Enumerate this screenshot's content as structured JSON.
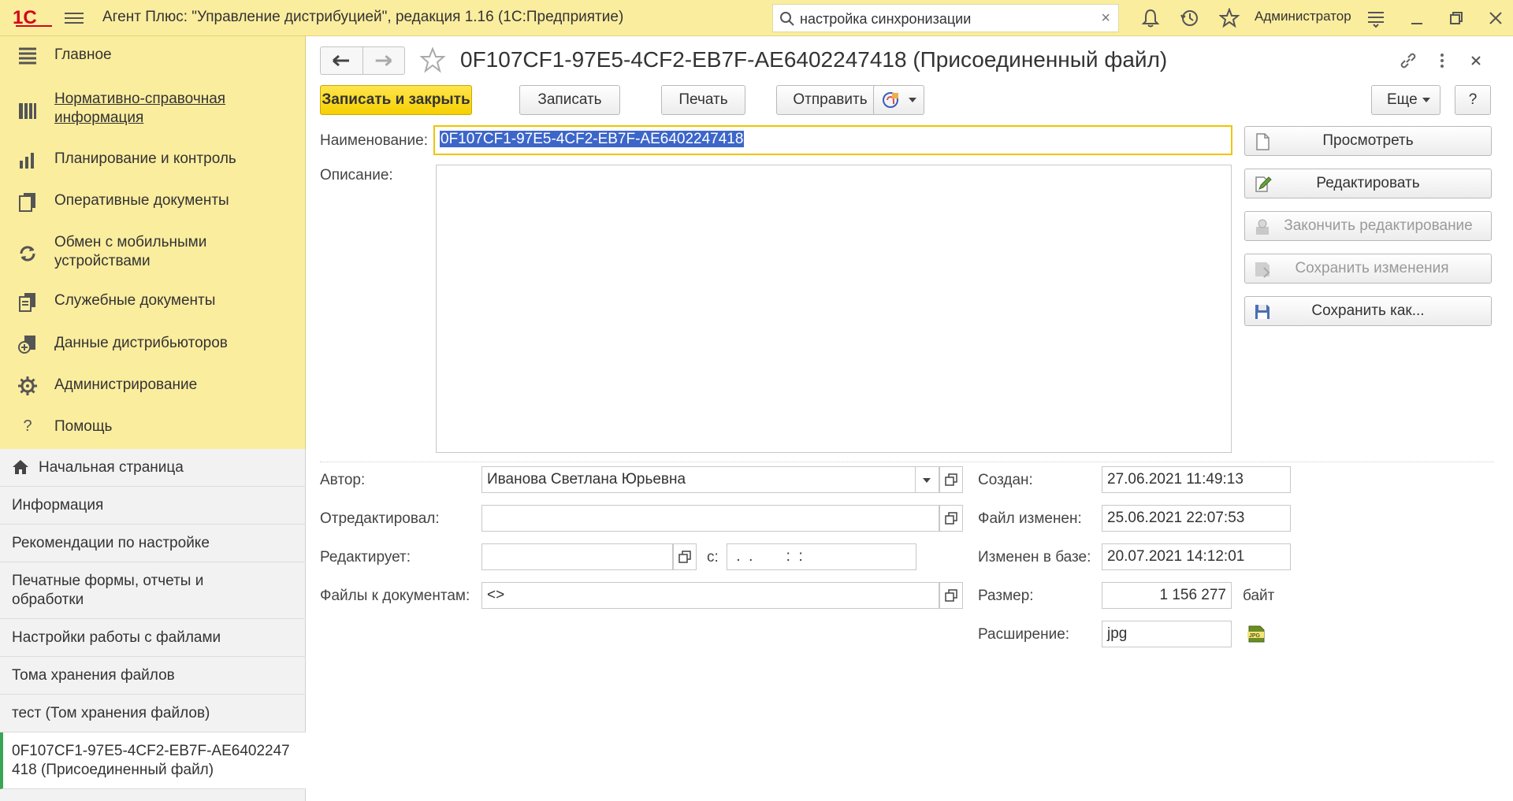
{
  "app": {
    "title": "Агент Плюс: \"Управление дистрибуцией\", редакция 1.16  (1С:Предприятие)",
    "search_value": "настройка синхронизации",
    "user": "Администратор"
  },
  "sections": [
    {
      "label": "Главное",
      "icon": "list-icon"
    },
    {
      "label": "Нормативно-справочная информация",
      "icon": "catalog-icon"
    },
    {
      "label": "Планирование и контроль",
      "icon": "chart-icon"
    },
    {
      "label": "Оперативные документы",
      "icon": "documents-icon"
    },
    {
      "label": "Обмен с мобильными устройствами",
      "icon": "sync-icon"
    },
    {
      "label": "Служебные документы",
      "icon": "service-docs-icon"
    },
    {
      "label": "Данные дистрибьюторов",
      "icon": "distributor-icon"
    },
    {
      "label": "Администрирование",
      "icon": "gear-icon"
    },
    {
      "label": "Помощь",
      "icon": "help-icon"
    }
  ],
  "open_windows": [
    {
      "label": "Начальная страница"
    },
    {
      "label": "Информация"
    },
    {
      "label": "Рекомендации по настройке"
    },
    {
      "label": "Печатные формы, отчеты и обработки"
    },
    {
      "label": "Настройки работы с файлами"
    },
    {
      "label": "Тома хранения файлов"
    },
    {
      "label": "тест (Том хранения файлов)"
    },
    {
      "label": "0F107CF1-97E5-4CF2-EB7F-AE6402247418 (Присоединенный файл)"
    }
  ],
  "form": {
    "title": "0F107CF1-97E5-4CF2-EB7F-AE6402247418 (Присоединенный файл)",
    "toolbar": {
      "save_close": "Записать и закрыть",
      "save": "Записать",
      "print": "Печать",
      "send": "Отправить",
      "more": "Еще",
      "help": "?"
    },
    "side_buttons": {
      "view": "Просмотреть",
      "edit": "Редактировать",
      "finish_edit": "Закончить редактирование",
      "save_changes": "Сохранить изменения",
      "save_as": "Сохранить как..."
    },
    "labels": {
      "name": "Наименование:",
      "description": "Описание:",
      "author": "Автор:",
      "edited_by": "Отредактировал:",
      "editing": "Редактирует:",
      "since": "с:",
      "files_to_docs": "Файлы к документам:",
      "created": "Создан:",
      "file_changed": "Файл изменен:",
      "changed_in_db": "Изменен в базе:",
      "size": "Размер:",
      "extension": "Расширение:",
      "bytes": "байт"
    },
    "values": {
      "name": "0F107CF1-97E5-4CF2-EB7F-AE6402247418",
      "description": "",
      "author": "Иванова Светлана Юрьевна",
      "edited_by": "",
      "editing": "",
      "since": " .  .        :  :",
      "files_to_docs": "<>",
      "created": "27.06.2021 11:49:13",
      "file_changed": "25.06.2021 22:07:53",
      "changed_in_db": "20.07.2021 14:12:01",
      "size": "1 156 277",
      "extension": "jpg"
    }
  }
}
